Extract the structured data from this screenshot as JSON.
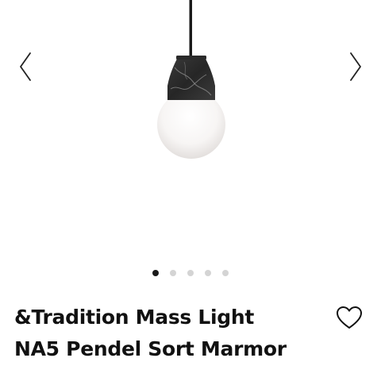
{
  "product": {
    "title_line1": "&Tradition Mass Light",
    "title_line2": "NA5 Pendel Sort Marmor"
  },
  "carousel": {
    "image_count": 5,
    "active_index": 0,
    "prev_icon": "chevron-left-icon",
    "next_icon": "chevron-right-icon"
  },
  "favorite": {
    "icon": "heart-outline-icon"
  },
  "colors": {
    "text": "#111111",
    "dot_active": "#1a1a1a",
    "dot_inactive": "#d4d4d4",
    "marble": "#2e2e2e"
  }
}
